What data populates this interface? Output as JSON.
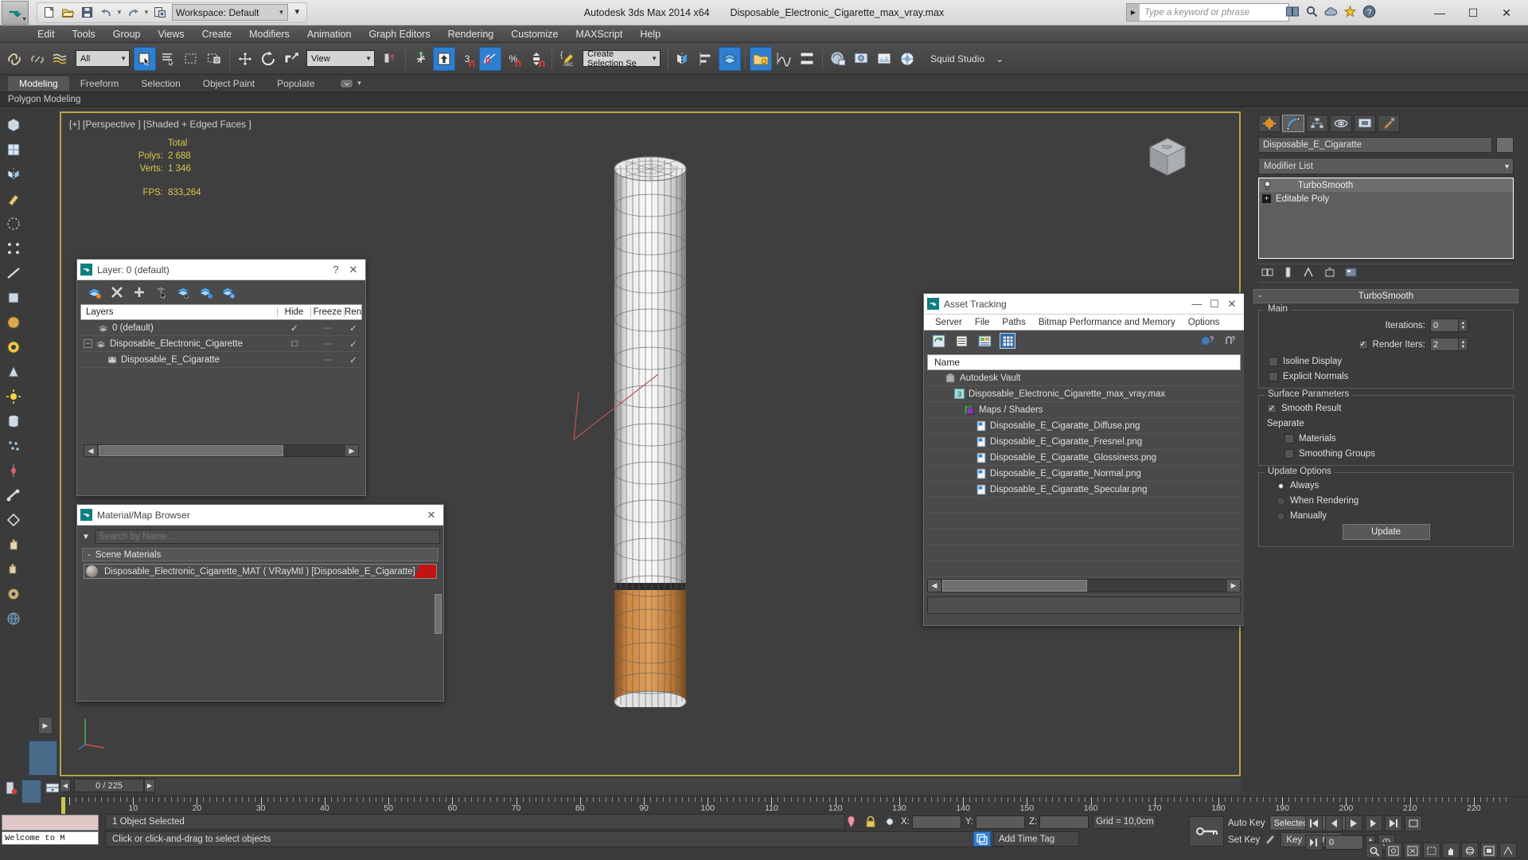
{
  "app": {
    "title": "Autodesk 3ds Max  2014 x64",
    "filename": "Disposable_Electronic_Cigarette_max_vray.max",
    "workspace_label": "Workspace: Default",
    "search_placeholder": "Type a keyword or phrase"
  },
  "window_buttons": {
    "minimize": "—",
    "maximize": "☐",
    "close": "✕"
  },
  "menu": [
    "Edit",
    "Tools",
    "Group",
    "Views",
    "Create",
    "Modifiers",
    "Animation",
    "Graph Editors",
    "Rendering",
    "Customize",
    "MAXScript",
    "Help"
  ],
  "toolbar": {
    "selection_filter": "All",
    "ref_coord_system": "View",
    "selection_set": "Create Selection Se",
    "snap_angle": "3",
    "studio_label": "Squid Studio",
    "studio_caret": "⌄"
  },
  "ribbon": {
    "tabs": [
      "Modeling",
      "Freeform",
      "Selection",
      "Object Paint",
      "Populate"
    ],
    "active_tab": "Modeling",
    "subtitle": "Polygon Modeling"
  },
  "viewport": {
    "label": "[+] [Perspective ] [Shaded + Edged Faces ]",
    "stats": {
      "header": "Total",
      "polys_label": "Polys:",
      "polys_value": "2 688",
      "verts_label": "Verts:",
      "verts_value": "1 346",
      "fps_label": "FPS:",
      "fps_value": "833,264"
    },
    "viewcube_label": "TOP"
  },
  "layer_dialog": {
    "title": "Layer: 0 (default)",
    "help_btn": "?",
    "close_btn": "✕",
    "columns": [
      "Layers",
      "Hide",
      "Freeze",
      "Ren"
    ],
    "rows": [
      {
        "name": "0 (default)",
        "indent": 0,
        "hide": "✓",
        "freeze": "—",
        "render": "✓",
        "type": "layer",
        "expander": ""
      },
      {
        "name": "Disposable_Electronic_Cigarette",
        "indent": 0,
        "hide": "□",
        "freeze": "—",
        "render": "✓",
        "type": "layer",
        "expander": "−"
      },
      {
        "name": "Disposable_E_Cigaratte",
        "indent": 1,
        "hide": "",
        "freeze": "—",
        "render": "✓",
        "type": "object",
        "expander": ""
      }
    ]
  },
  "material_browser": {
    "title": "Material/Map Browser",
    "close_btn": "✕",
    "search_placeholder": "Search by Name ...",
    "search_value": "",
    "group_label": "Scene Materials",
    "group_toggle": "-",
    "items": [
      {
        "label": "Disposable_Electronic_Cigarette_MAT ( VRayMtl ) [Disposable_E_Cigaratte]",
        "swatch_color": "#c21414"
      }
    ]
  },
  "asset_tracking": {
    "title": "Asset Tracking",
    "minimize": "—",
    "maximize": "☐",
    "close": "✕",
    "menu": [
      "Server",
      "File",
      "Paths",
      "Bitmap Performance and Memory",
      "Options"
    ],
    "column_header": "Name",
    "rows": [
      {
        "label": "Autodesk Vault",
        "indent": 0,
        "icon": "vault-icon",
        "badge": ""
      },
      {
        "label": "Disposable_Electronic_Cigarette_max_vray.max",
        "indent": 1,
        "icon": "max-file-icon",
        "badge": "3"
      },
      {
        "label": "Maps / Shaders",
        "indent": 2,
        "icon": "maps-icon",
        "badge": ""
      },
      {
        "label": "Disposable_E_Cigaratte_Diffuse.png",
        "indent": 3,
        "icon": "bitmap-icon",
        "badge": ""
      },
      {
        "label": "Disposable_E_Cigaratte_Fresnel.png",
        "indent": 3,
        "icon": "bitmap-icon",
        "badge": ""
      },
      {
        "label": "Disposable_E_Cigaratte_Glossiness.png",
        "indent": 3,
        "icon": "bitmap-icon",
        "badge": ""
      },
      {
        "label": "Disposable_E_Cigaratte_Normal.png",
        "indent": 3,
        "icon": "bitmap-icon",
        "badge": ""
      },
      {
        "label": "Disposable_E_Cigaratte_Specular.png",
        "indent": 3,
        "icon": "bitmap-icon",
        "badge": ""
      }
    ]
  },
  "command_panel": {
    "object_name": "Disposable_E_Cigaratte",
    "modifier_list_label": "Modifier List",
    "stack": [
      {
        "label": "TurboSmooth",
        "selected": true
      },
      {
        "label": "Editable Poly",
        "selected": false
      }
    ],
    "rollout_title": "TurboSmooth",
    "rollout_minus": "-",
    "groups": {
      "main": {
        "label": "Main",
        "iterations_label": "Iterations:",
        "iterations_value": "0",
        "render_iters_label": "Render Iters:",
        "render_iters_value": "2",
        "render_iters_checked": true,
        "isoline_label": "Isoline Display",
        "isoline_checked": false,
        "explicit_normals_label": "Explicit Normals",
        "explicit_normals_checked": false
      },
      "surface": {
        "label": "Surface Parameters",
        "smooth_result_label": "Smooth Result",
        "smooth_result_checked": true,
        "separate_label": "Separate",
        "materials_label": "Materials",
        "materials_checked": false,
        "smoothing_groups_label": "Smoothing Groups",
        "smoothing_groups_checked": false
      },
      "update": {
        "label": "Update Options",
        "options": [
          "Always",
          "When Rendering",
          "Manually"
        ],
        "selected": "Always",
        "button_label": "Update"
      }
    }
  },
  "timeline": {
    "frame_display": "0 / 225",
    "prev_arrow": "◀",
    "next_arrow": "▶",
    "ruler_ticks": [
      10,
      20,
      30,
      40,
      50,
      60,
      70,
      80,
      90,
      100,
      110,
      120,
      130,
      140,
      150,
      160,
      170,
      180,
      190,
      200,
      210,
      220
    ]
  },
  "status": {
    "prompt_text": "Welcome to M",
    "selection_text": "1 Object Selected",
    "hint_text": "Click or click-and-drag to select objects",
    "coords": {
      "x_label": "X:",
      "x_value": "",
      "y_label": "Y:",
      "y_value": "",
      "z_label": "Z:",
      "z_value": ""
    },
    "grid_label": "Grid = 10,0cm",
    "add_time_tag": "Add Time Tag",
    "auto_key": "Auto Key",
    "set_key": "Set Key",
    "key_filters": "Key Filters...",
    "selected_combo": "Selected",
    "key_frame_value": "0"
  },
  "colors": {
    "accent_blue": "#2f7fd1",
    "viewport_border": "#b8a44a",
    "stats_yellow": "#d8c84c",
    "swatch_red": "#c21414"
  }
}
